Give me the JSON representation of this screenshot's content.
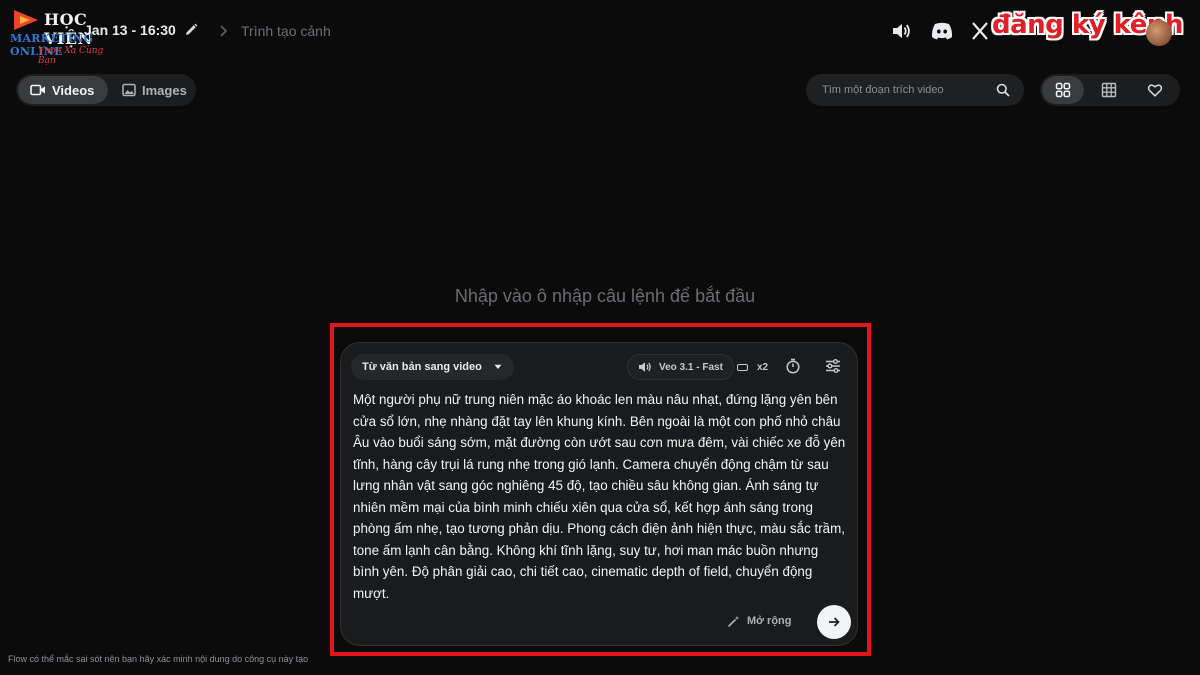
{
  "logo": {
    "line1": "HỌC VIỆN",
    "line2": "MARKETING ONLINE",
    "line3": "Vươn Xa Cùng Bạn"
  },
  "header": {
    "project_title": "Jan 13 - 16:30",
    "breadcrumb": "Trình tạo cảnh",
    "subscribe_banner": "đăng ký kênh",
    "icons": [
      "pencil-icon",
      "chevron-right-icon",
      "speaker-icon",
      "discord-icon",
      "x-icon",
      "avatar"
    ]
  },
  "tabs": [
    {
      "label": "Videos",
      "icon": "video-icon",
      "active": true
    },
    {
      "label": "Images",
      "icon": "image-icon",
      "active": false
    }
  ],
  "search": {
    "placeholder": "Tìm một đoạn trích video"
  },
  "view_modes": [
    {
      "icon": "grid-2-icon",
      "active": true
    },
    {
      "icon": "grid-3-icon",
      "active": false
    },
    {
      "icon": "heart-icon",
      "active": false
    }
  ],
  "main": {
    "hint": "Nhập vào ô nhập câu lệnh để bắt đầu"
  },
  "prompt": {
    "mode": "Từ văn bản sang video",
    "model": "Veo 3.1 - Fast",
    "count": "x2",
    "text": "Một người phụ nữ trung niên mặc áo khoác len màu nâu nhạt, đứng lặng yên bên cửa sổ lớn, nhẹ nhàng đặt tay lên khung kính. Bên ngoài là một con phố nhỏ châu Âu vào buổi sáng sớm, mặt đường còn ướt sau cơn mưa đêm, vài chiếc xe đỗ yên tĩnh, hàng cây trụi lá rung nhẹ trong gió lạnh. Camera chuyển động chậm từ sau lưng nhân vật sang góc nghiêng 45 độ, tạo chiều sâu không gian. Ánh sáng tự nhiên mềm mại của bình minh chiếu xiên qua cửa sổ, kết hợp ánh sáng trong phòng ấm nhẹ, tạo tương phản dịu. Phong cách điện ảnh hiện thực, màu sắc trầm, tone ấm lạnh cân bằng. Không khí tĩnh lặng, suy tư, hơi man mác buồn nhưng bình yên. Độ phân giải cao, chi tiết cao, cinematic depth of field, chuyển động mượt.",
    "expand_label": "Mở rộng"
  },
  "footer": {
    "disclaimer": "Flow có thể mắc sai sót nên bạn hãy xác minh nội dung do công cụ này tạo"
  },
  "colors": {
    "background": "#0b0b0c",
    "panel": "#1a1b1d",
    "highlight": "#e3141b",
    "banner": "#e21f26"
  }
}
